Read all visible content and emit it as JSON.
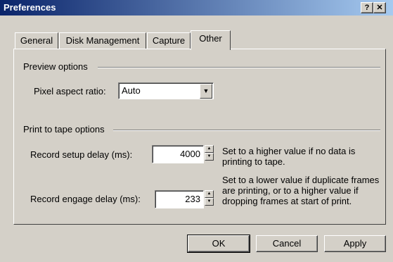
{
  "window": {
    "title": "Preferences",
    "help_glyph": "?",
    "close_glyph": "✕"
  },
  "tabs": [
    "General",
    "Disk Management",
    "Capture",
    "Other"
  ],
  "active_tab": "Other",
  "preview": {
    "group_label": "Preview options",
    "pixel_aspect_label": "Pixel aspect ratio:",
    "pixel_aspect_value": "Auto"
  },
  "print": {
    "group_label": "Print to tape options",
    "setup_delay_label": "Record setup delay (ms):",
    "setup_delay_value": "4000",
    "setup_help": "Set to a higher value if no data is printing to tape.",
    "engage_delay_label": "Record engage delay (ms):",
    "engage_delay_value": "233",
    "engage_help": "Set to a lower value if duplicate frames are printing, or to a higher value if dropping frames at start of print."
  },
  "buttons": {
    "ok": "OK",
    "cancel": "Cancel",
    "apply": "Apply"
  }
}
